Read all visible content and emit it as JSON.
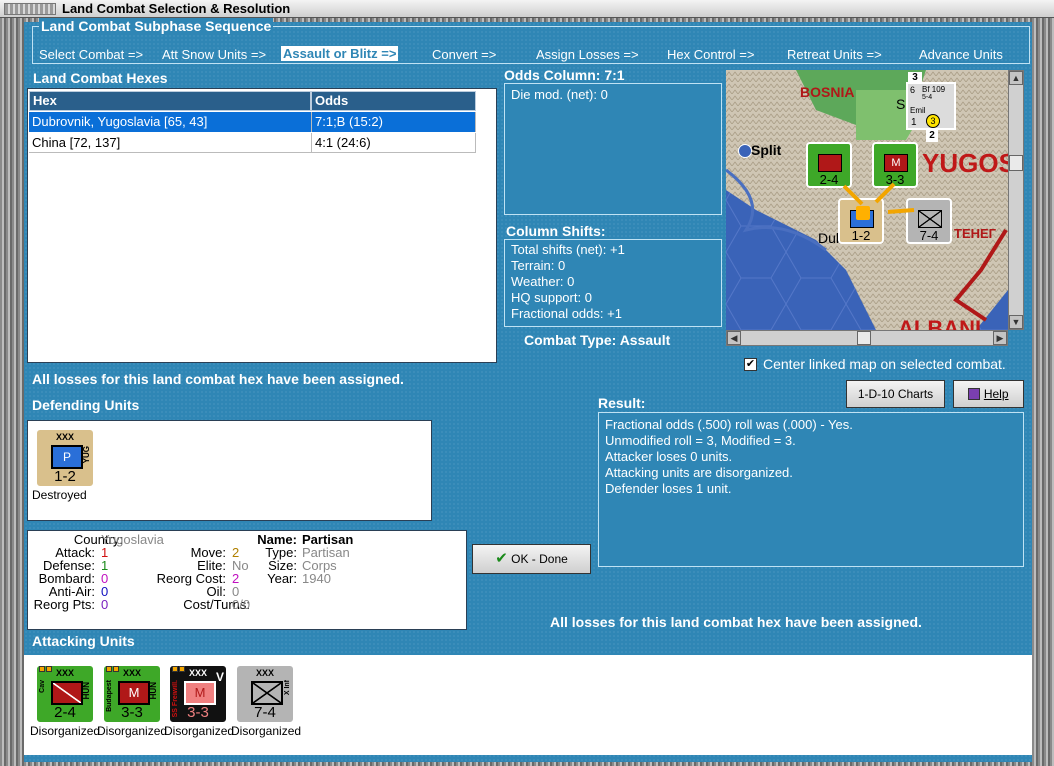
{
  "window": {
    "title": "Land Combat Selection & Resolution"
  },
  "subphase": {
    "title": "Land Combat Subphase Sequence",
    "steps": [
      "Select Combat =>",
      "Att Snow Units =>",
      "Assault or Blitz =>",
      "Convert =>",
      "Assign Losses =>",
      "Hex Control =>",
      "Retreat Units =>",
      "Advance Units"
    ],
    "active_index": 2
  },
  "hexes": {
    "title": "Land Combat Hexes",
    "col_hex": "Hex",
    "col_odds": "Odds",
    "rows": [
      {
        "hex": "Dubrovnik, Yugoslavia [65, 43]",
        "odds": "7:1;B (15:2)"
      },
      {
        "hex": "China [72, 137]",
        "odds": "4:1 (24:6)"
      }
    ]
  },
  "odds": {
    "title": "Odds Column: 7:1",
    "die_mod": "Die mod. (net): 0"
  },
  "shifts": {
    "title": "Column Shifts:",
    "lines": [
      "Total shifts (net): +1",
      "Terrain: 0",
      "Weather: 0",
      "HQ support: 0",
      "Fractional odds: +1"
    ]
  },
  "combat_type": {
    "label": "Combat Type:",
    "value": "Assault"
  },
  "map": {
    "labels": {
      "bosnia": "BOSNIA",
      "sarajevo": "Sarajevo",
      "split": "Split",
      "yugos": "YUGOS",
      "dubrovnik": "Dubrovnik",
      "montenegro": "ТЕНЕГ",
      "albania": "ALBANI"
    },
    "stack_counts": [
      "3",
      "2"
    ],
    "air_unit": {
      "top": "Bf 109",
      "mid": "6",
      "sub": "5-4",
      "name": "Emil",
      "n": "1",
      "badge": "3"
    }
  },
  "center_map": {
    "label": "Center linked map on selected combat.",
    "checked": true
  },
  "buttons": {
    "charts": "1-D-10 Charts",
    "help": "Help",
    "ok": "OK - Done"
  },
  "loss_note": "All losses for this land combat hex have been assigned.",
  "defending": {
    "title": "Defending Units",
    "units": [
      {
        "size": "XXX",
        "sym": "P",
        "side": "YUG",
        "value": "1-2",
        "status": "Destroyed"
      }
    ]
  },
  "result": {
    "title": "Result:",
    "lines": [
      "Fractional odds (.500) roll was (.000)  - Yes.",
      "Unmodified roll = 3, Modified = 3.",
      "Attacker loses 0 units.",
      "Attacking units are disorganized.",
      "Defender loses 1 unit."
    ]
  },
  "details": {
    "country_k": "Country:",
    "country_v": "Yugoslavia",
    "attack_k": "Attack:",
    "attack_v": "1",
    "defense_k": "Defense:",
    "defense_v": "1",
    "bombard_k": "Bombard:",
    "bombard_v": "0",
    "antiair_k": "Anti-Air:",
    "antiair_v": "0",
    "reorgpts_k": "Reorg Pts:",
    "reorgpts_v": "0",
    "move_k": "Move:",
    "move_v": "2",
    "elite_k": "Elite:",
    "elite_v": "No",
    "reorgcost_k": "Reorg Cost:",
    "reorgcost_v": "2",
    "oil_k": "Oil:",
    "oil_v": "0",
    "costturns_k": "Cost/Turns:",
    "costturns_v": "0/0",
    "name_k": "Name:",
    "name_v": "Partisan",
    "type_k": "Type:",
    "type_v": "Partisan",
    "size_k": "Size:",
    "size_v": "Corps",
    "year_k": "Year:",
    "year_v": "1940"
  },
  "attacking": {
    "title": "Attacking Units",
    "units": [
      {
        "size": "XXX",
        "side": "HUN",
        "lside": "Cav",
        "value": "2-4",
        "status": "Disorganized"
      },
      {
        "size": "XXX",
        "side": "HUN",
        "lside": "Budapest",
        "sym": "M",
        "value": "3-3",
        "status": "Disorganized"
      },
      {
        "size": "XXX",
        "side": "V",
        "lside": "SS Freiwill.",
        "sym": "M",
        "value": "3-3",
        "status": "Disorganized"
      },
      {
        "size": "XXX",
        "side": "",
        "lside": "X Inf",
        "value": "7-4",
        "status": "Disorganized"
      }
    ]
  },
  "colors": {
    "panel": "#2f86b5",
    "selection": "#0a6fd8",
    "hun_green": "#3ea828",
    "german_black": "#111111",
    "italian_gray": "#b4b4b4",
    "yug_tan": "#d9c08c"
  }
}
